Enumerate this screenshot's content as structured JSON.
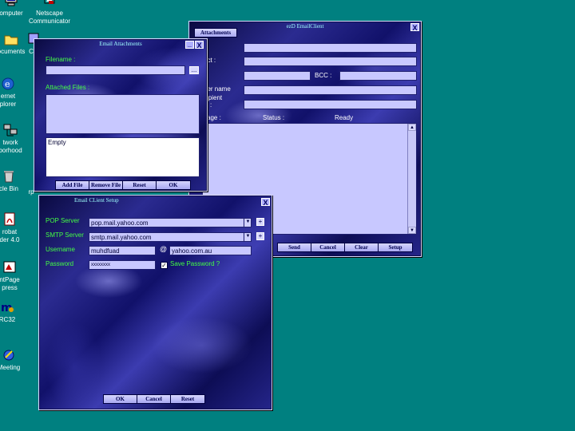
{
  "desktop": {
    "icons": [
      {
        "label_lines": [
          "omputer"
        ],
        "icon": "computer-icon"
      },
      {
        "label_lines": [
          "Netscape",
          "Communicator"
        ],
        "icon": "netscape-icon"
      },
      {
        "label_lines": [
          "ocuments"
        ],
        "icon": "folder-icon"
      },
      {
        "label_lines": [
          "C"
        ],
        "icon": "partial-icon"
      },
      {
        "label_lines": [
          "ernet",
          "plorer"
        ],
        "icon": "internet-explorer-icon"
      },
      {
        "label_lines": [
          "twork",
          "borhood"
        ],
        "icon": "network-icon"
      },
      {
        "label_lines": [
          "cle Bin"
        ],
        "icon": "recycle-bin-icon"
      },
      {
        "label_lines": [
          "rp"
        ],
        "icon": "partial-icon"
      },
      {
        "label_lines": [
          "robat",
          "der 4.0"
        ],
        "icon": "acrobat-icon"
      },
      {
        "label_lines": [
          "ntPage",
          "press"
        ],
        "icon": "frontpage-icon"
      },
      {
        "label_lines": [
          "RC32"
        ],
        "icon": "mirc-icon"
      },
      {
        "label_lines": [
          "Meeting"
        ],
        "icon": "netmeeting-icon"
      }
    ]
  },
  "email_client": {
    "title": "ezD EmailClient",
    "attachments_button": "Attachments",
    "close_label": "X",
    "labels": {
      "subject": "act :",
      "bcc": "BCC :",
      "sender_name": "der name",
      "recipient": "ipient",
      "to": ":",
      "message": "sage :",
      "status": "Status :",
      "status_value": "Ready"
    },
    "buttons": [
      "Send",
      "Cancel",
      "Clear",
      "Setup"
    ],
    "scroll_up": "▲",
    "scroll_down": "▼"
  },
  "attachments_window": {
    "title": "Email Attachments",
    "min_label": "_",
    "close_label": "X",
    "filename_label": "Filename :",
    "filename_value": "",
    "browse_label": "...",
    "attached_files_label": "Attached Files :",
    "list_value": "Empty",
    "buttons": [
      "Add File",
      "Remove File",
      "Reset",
      "OK"
    ]
  },
  "setup_window": {
    "title": "Email CLient Setup",
    "close_label": "X",
    "pop_label": "POP Server",
    "pop_value": "pop.mail.yahoo.com",
    "smtp_label": "SMTP Server",
    "smtp_value": "smtp.mail.yahoo.com",
    "username_label": "Username",
    "username_value": "muhdfuad",
    "at_symbol": "@",
    "domain_value": "yahoo.com.au",
    "password_label": "Password",
    "password_value": "xxxxxxxx",
    "save_password_label": "Save Password ?",
    "save_password_checked": "✓",
    "add_label": "+",
    "dropdown_arrow": "▼",
    "buttons": [
      "OK",
      "Cancel",
      "Reset"
    ]
  },
  "colors": {
    "desktop": "#008080",
    "label_green": "#44ff44",
    "field": "#c8c8ff"
  }
}
